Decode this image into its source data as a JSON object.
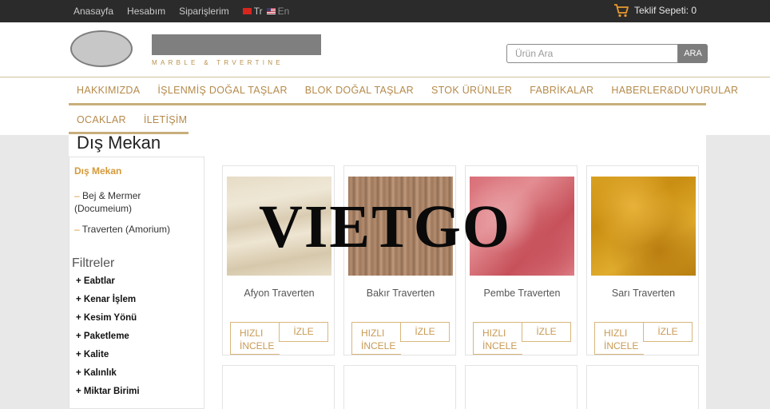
{
  "topbar": {
    "links": [
      "Anasayfa",
      "Hesabım",
      "Siparişlerim"
    ],
    "lang_tr": "Tr",
    "lang_en": "En",
    "cart_label": "Teklif Sepeti: 0"
  },
  "header": {
    "logo_tagline": "MARBLE & TRVERTINE",
    "search_placeholder": "Ürün Ara",
    "search_button": "ARA"
  },
  "nav": {
    "row1": [
      "HAKKIMIZDA",
      "İŞLENMİŞ DOĞAL TAŞLAR",
      "BLOK DOĞAL TAŞLAR",
      "STOK ÜRÜNLER",
      "FABRİKALAR",
      "HABERLER&DUYURULAR"
    ],
    "row2": [
      "OCAKLAR",
      "İLETİŞİM"
    ]
  },
  "page": {
    "title": "Dış Mekan"
  },
  "sidebar": {
    "category_title": "Dış Mekan",
    "items": [
      "Bej & Mermer (Documeium)",
      "Traverten (Amorium)"
    ],
    "filters_title": "Filtreler",
    "filters": [
      "+ Eabtlar",
      "+ Kenar İşlem",
      "+ Kesim Yönü",
      "+ Paketleme",
      "+ Kalite",
      "+ Kalınlık",
      "+ Miktar Birimi"
    ]
  },
  "products": [
    {
      "name": "Afyon Traverten",
      "quick_view": "HIZLI İNCELE",
      "view": "İZLE"
    },
    {
      "name": "Bakır Traverten",
      "quick_view": "HIZLI İNCELE",
      "view": "İZLE"
    },
    {
      "name": "Pembe Traverten",
      "quick_view": "HIZLI İNCELE",
      "view": "İZLE"
    },
    {
      "name": "Sarı Traverten",
      "quick_view": "HIZLI İNCELE",
      "view": "İZLE"
    }
  ],
  "watermark": "VIETGO",
  "colors": {
    "accent_gold": "#b58a4b",
    "topbar_bg": "#2b2b2b",
    "category_orange": "#d59a3a"
  }
}
